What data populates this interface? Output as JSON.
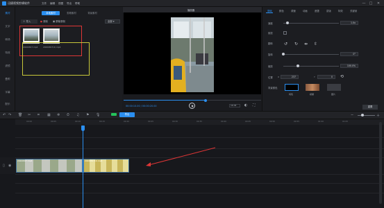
{
  "app": {
    "title": "迅捷视频剪辑软件"
  },
  "menu": [
    "文件",
    "编辑",
    "视图",
    "导出",
    "帮助"
  ],
  "window_controls": [
    "—",
    "□",
    "✕"
  ],
  "rail": [
    "素材",
    "文字",
    "转场",
    "特效",
    "滤镜",
    "叠附",
    "字幕",
    "配乐"
  ],
  "media": {
    "tabs": [
      "本地素材",
      "剪辑素材",
      "背景素材"
    ],
    "import_label": "导入",
    "record_label": "录制",
    "screen_label": "屏幕录制",
    "filter_label": "全部",
    "thumbs": [
      {
        "caption": "00:00:16"
      },
      {
        "caption": "00:00:09"
      }
    ],
    "filenames": [
      "20200817.mp4",
      "20200817(2).mp4"
    ]
  },
  "preview": {
    "title": "播放器",
    "timecode": "00:00:10.00 / 00:00:20.00",
    "ratio": "16:9",
    "progress": 0.59
  },
  "props": {
    "tabs": [
      "基础",
      "颜色",
      "调速",
      "动画",
      "遮罩",
      "蒙版",
      "特效",
      "关键帧"
    ],
    "rows": [
      {
        "label": "速度",
        "value": "1.0x"
      },
      {
        "label": "倒放",
        "value": ""
      },
      {
        "label": "翻转",
        "value": ""
      },
      {
        "label": "旋转",
        "value": "0°"
      },
      {
        "label": "缩放",
        "value": "100.0%"
      },
      {
        "label": "位置",
        "value": "237"
      },
      {
        "label": "背景颜色",
        "value": ""
      }
    ],
    "pos_y": "0",
    "bg_options": [
      "纯色",
      "模糊",
      "图片"
    ],
    "reset_label": "重置"
  },
  "toolbar": {
    "export_label": "导出"
  },
  "timeline": {
    "ticks": [
      "00:00",
      "00:05",
      "00:10",
      "00:15",
      "00:20",
      "00:25",
      "00:30",
      "00:35",
      "00:40",
      "00:45",
      "00:50",
      "00:55",
      "01:00",
      "01:05"
    ],
    "clips": [
      "20200817.mp4",
      "20200817(2).mp4"
    ]
  }
}
